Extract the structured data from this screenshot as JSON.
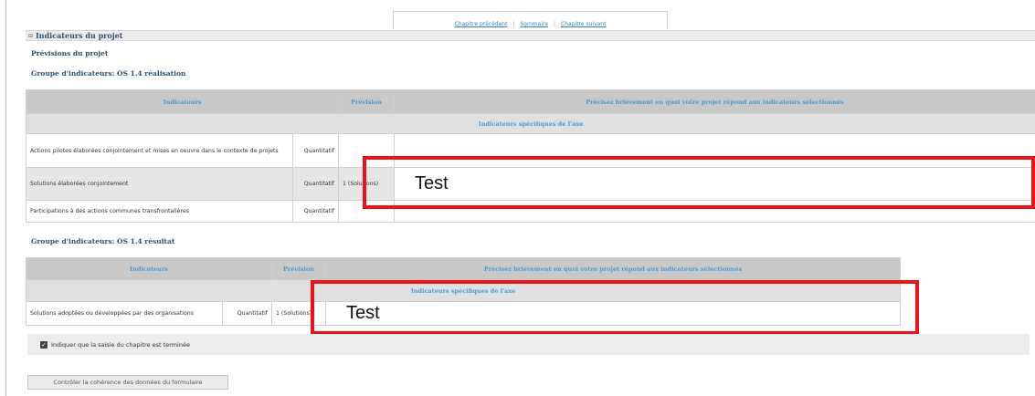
{
  "nav": {
    "previous": "Chapitre précédent",
    "summary": "Sommaire",
    "next": "Chapitre suivant"
  },
  "section": {
    "toggle": "⊟",
    "title": "Indicateurs du projet"
  },
  "forecast_title": "Prévisions du projet",
  "group1": {
    "title": "Groupe d'indicateurs: OS 1.4 réalisation",
    "headers": {
      "indicators": "Indicateurs",
      "forecast": "Prévision",
      "description": "Précisez brièvement en quoi votre projet répond aux indicateurs sélectionnés"
    },
    "subheader": "Indicateurs spécifiques de l'axe",
    "rows": [
      {
        "label": "Actions pilotes élaborées conjointement et mises en oeuvre dans le contexte de projets",
        "type": "Quantitatif",
        "forecast": "",
        "answer": ""
      },
      {
        "label": "Solutions élaborées conjointement",
        "type": "Quantitatif",
        "forecast": "1 (Solutions)",
        "answer": "Test"
      },
      {
        "label": "Participations à des actions communes transfrontalières",
        "type": "Quantitatif",
        "forecast": "",
        "answer": ""
      }
    ]
  },
  "group2": {
    "title": "Groupe d'indicateurs: OS 1.4 résultat",
    "headers": {
      "indicators": "Indicateurs",
      "forecast": "Prévision",
      "description": "Précisez brièvement en quoi votre projet répond aux indicateurs sélectionnés"
    },
    "subheader": "Indicateurs spécifiques de l'axe",
    "rows": [
      {
        "label": "Solutions adoptées ou développées par des organisations",
        "type": "Quantitatif",
        "forecast": "1 (Solutions)",
        "answer": "Test"
      }
    ]
  },
  "completion": {
    "checked": true,
    "label": "Indiquer que la saisie du chapitre est terminée"
  },
  "check_button": "Contrôler la cohérence des données du formulaire",
  "colors": {
    "highlight": "#e8141b",
    "header_text": "#4a9ad0",
    "title_text": "#2e4f6e"
  }
}
